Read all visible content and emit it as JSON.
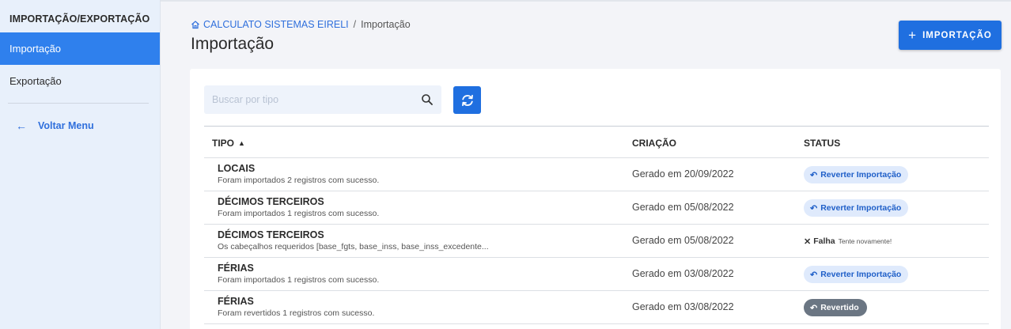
{
  "sidebar": {
    "title": "IMPORTAÇÃO/EXPORTAÇÃO",
    "items": [
      {
        "label": "Importação",
        "active": true
      },
      {
        "label": "Exportação",
        "active": false
      }
    ],
    "back_label": "Voltar Menu"
  },
  "header": {
    "breadcrumb": {
      "home": "CALCULATO SISTEMAS EIRELI",
      "separator": "/",
      "current": "Importação"
    },
    "title": "Importação",
    "add_button_label": "IMPORTAÇÃO"
  },
  "search": {
    "placeholder": "Buscar por tipo",
    "value": ""
  },
  "table": {
    "columns": {
      "tipo": "TIPO",
      "criacao": "CRIAÇÃO",
      "status": "STATUS"
    },
    "rows": [
      {
        "title": "LOCAIS",
        "desc": "Foram importados 2 registros com sucesso.",
        "created": "Gerado em 20/09/2022",
        "status": "Reverter Importação"
      },
      {
        "title": "DÉCIMOS TERCEIROS",
        "desc": "Foram importados 1 registros com sucesso.",
        "created": "Gerado em 05/08/2022",
        "status": "Reverter Importação"
      },
      {
        "title": "DÉCIMOS TERCEIROS",
        "desc": "Os cabeçalhos requeridos [base_fgts, base_inss, base_inss_excedente...",
        "created": "Gerado em 05/08/2022",
        "status": "Falha",
        "status_hint": "Tente novamente!"
      },
      {
        "title": "FÉRIAS",
        "desc": "Foram importados 1 registros com sucesso.",
        "created": "Gerado em 03/08/2022",
        "status": "Reverter Importação"
      },
      {
        "title": "FÉRIAS",
        "desc": "Foram revertidos 1 registros com sucesso.",
        "created": "Gerado em 03/08/2022",
        "status": "Revertido"
      }
    ]
  },
  "colors": {
    "primary": "#1f6fe0",
    "sidebar_bg": "#e8f0fb",
    "chip_bg": "#dfeafc",
    "reverted_bg": "#6b7683"
  }
}
